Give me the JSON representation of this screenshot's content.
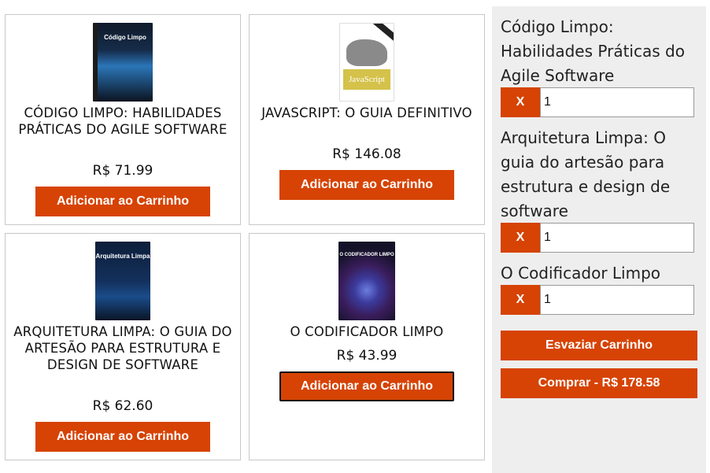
{
  "products": [
    {
      "title": "CÓDIGO LIMPO: HABILIDADES PRÁTICAS DO AGILE SOFTWARE",
      "price": "R$ 71.99",
      "button": "Adicionar ao Carrinho",
      "cover_title": "Código Limpo"
    },
    {
      "title": "JAVASCRIPT: O GUIA DEFINITIVO",
      "price": "R$ 146.08",
      "button": "Adicionar ao Carrinho",
      "cover_title": "JavaScript"
    },
    {
      "title": "ARQUITETURA LIMPA: O GUIA DO ARTESÃO PARA ESTRUTURA E DESIGN DE SOFTWARE",
      "price": "R$ 62.60",
      "button": "Adicionar ao Carrinho",
      "cover_title": "Arquitetura Limpa"
    },
    {
      "title": "O CODIFICADOR LIMPO",
      "price": "R$ 43.99",
      "button": "Adicionar ao Carrinho",
      "cover_title": "O CODIFICADOR LIMPO"
    }
  ],
  "cart": {
    "items": [
      {
        "title": "Código Limpo: Habilidades Práticas do Agile Software",
        "remove_label": "X",
        "quantity": "1"
      },
      {
        "title": "Arquitetura Limpa: O guia do artesão para estrutura e design de software",
        "remove_label": "X",
        "quantity": "1"
      },
      {
        "title": "O Codificador Limpo",
        "remove_label": "X",
        "quantity": "1"
      }
    ],
    "empty_label": "Esvaziar Carrinho",
    "buy_label": "Comprar - R$ 178.58"
  },
  "colors": {
    "accent": "#d64304",
    "cart_bg": "#eeeeee",
    "card_border": "#c8c8c8"
  }
}
